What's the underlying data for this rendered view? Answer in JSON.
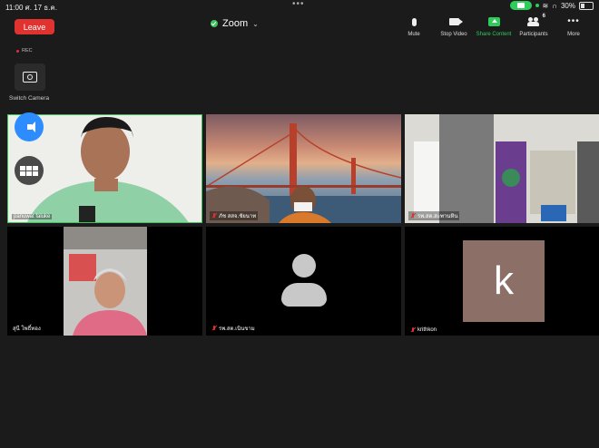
{
  "status_bar": {
    "time": "11:00  ศ. 17 ธ.ค.",
    "battery": "30%"
  },
  "header": {
    "leave_label": "Leave",
    "title": "Zoom"
  },
  "toolbar": {
    "mute": "Mute",
    "stop_video": "Stop Video",
    "share_content": "Share Content",
    "participants": "Participants",
    "participants_count": "6",
    "more": "More"
  },
  "rec_label": "REC",
  "switch_camera_label": "Switch Camera",
  "participants": [
    {
      "name": "panuwat faluke",
      "muted": false
    },
    {
      "name": "ภัช สสจ.ชัยนาท",
      "muted": true
    },
    {
      "name": "รพ.สต.สะพานหิน",
      "muted": true
    },
    {
      "name": "สุนี โพธิ์ทอง",
      "muted": false
    },
    {
      "name": "รพ.สต.เนินขาม",
      "muted": true
    },
    {
      "name": "krithkon",
      "muted": true,
      "avatar_letter": "k"
    }
  ],
  "colors": {
    "leave": "#e0322f",
    "share": "#2ecc5b",
    "active_border": "#3ec35c",
    "speaker_btn": "#2d8cff"
  }
}
